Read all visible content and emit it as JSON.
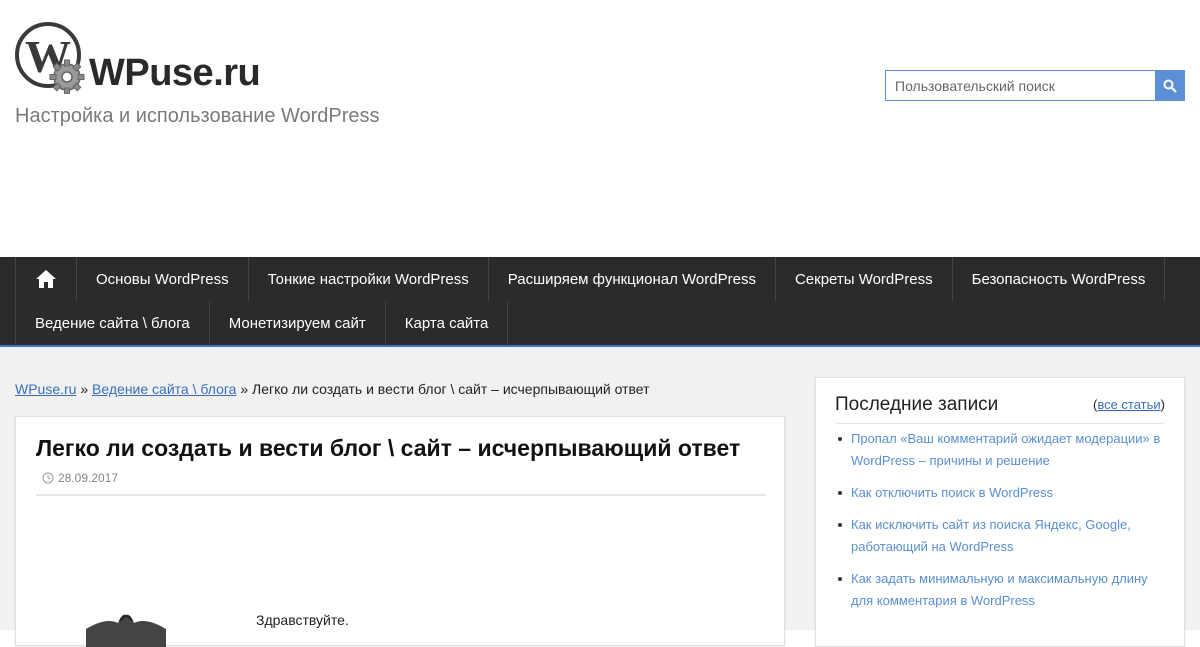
{
  "site": {
    "name": "WPuse.ru",
    "tagline": "Настройка и использование WordPress"
  },
  "search": {
    "placeholder": "Пользовательский поиск",
    "icon": "search-icon"
  },
  "nav": {
    "home_icon": "home-icon",
    "row1": [
      "Основы WordPress",
      "Тонкие настройки WordPress",
      "Расширяем функционал WordPress",
      "Секреты WordPress",
      "Безопасность WordPress"
    ],
    "row2": [
      "Ведение сайта \\ блога",
      "Монетизируем сайт",
      "Карта сайта"
    ]
  },
  "breadcrumb": {
    "home": "WPuse.ru",
    "sep1": "»",
    "category": "Ведение сайта \\ блога",
    "sep2": "»",
    "current": "Легко ли создать и вести блог \\ сайт – исчерпывающий ответ"
  },
  "article": {
    "title": "Легко ли создать и вести блог \\ сайт – исчерпывающий ответ",
    "date": "28.09.2017",
    "greeting": "Здравствуйте."
  },
  "sidebar": {
    "title": "Последние записи",
    "all_open": "(",
    "all_link": "все статьи",
    "all_close": ")",
    "posts": [
      "Пропал «Ваш комментарий ожидает модерации» в WordPress – причины и решение",
      "Как отключить поиск в WordPress",
      "Как исключить сайт из поиска Яндекс, Google, работающий на WordPress",
      "Как задать минимальную и максимальную длину для комментария в WordPress"
    ]
  },
  "colors": {
    "accent": "#5c8fd6",
    "nav_bg": "#2b2b2b",
    "link": "#3a6fb8"
  }
}
